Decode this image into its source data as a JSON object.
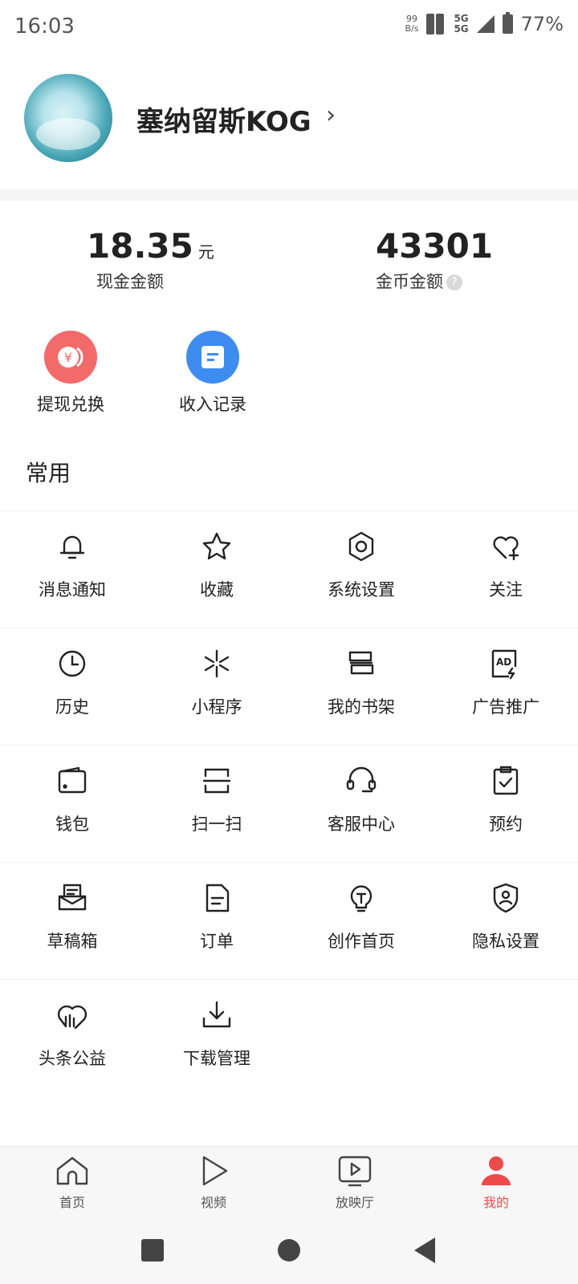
{
  "status_bar": {
    "time": "16:03",
    "net_speed_value": "99",
    "net_speed_unit": "B/s",
    "network_type_1": "5G",
    "network_type_2": "5G",
    "battery": "77%"
  },
  "profile": {
    "username": "塞纳留斯KOG",
    "chevron": "›"
  },
  "stats": {
    "cash_amount": "18.35",
    "cash_unit": "元",
    "cash_label": "现金金额",
    "coin_amount": "43301",
    "coin_label": "金币金额",
    "help_glyph": "?"
  },
  "quick_actions": {
    "withdraw_label": "提现兑换",
    "withdraw_icon_glyph": "¥",
    "income_label": "收入记录"
  },
  "section_title": "常用",
  "grid": {
    "items": [
      {
        "label": "消息通知",
        "icon": "bell-icon"
      },
      {
        "label": "收藏",
        "icon": "star-icon"
      },
      {
        "label": "系统设置",
        "icon": "gear-icon"
      },
      {
        "label": "关注",
        "icon": "heart-plus-icon"
      },
      {
        "label": "历史",
        "icon": "clock-icon"
      },
      {
        "label": "小程序",
        "icon": "mini-program-icon"
      },
      {
        "label": "我的书架",
        "icon": "bookshelf-icon"
      },
      {
        "label": "广告推广",
        "icon": "ad-icon"
      },
      {
        "label": "钱包",
        "icon": "wallet-icon"
      },
      {
        "label": "扫一扫",
        "icon": "scan-icon"
      },
      {
        "label": "客服中心",
        "icon": "headset-icon"
      },
      {
        "label": "预约",
        "icon": "clipboard-check-icon"
      },
      {
        "label": "草稿箱",
        "icon": "drafts-icon"
      },
      {
        "label": "订单",
        "icon": "document-icon"
      },
      {
        "label": "创作首页",
        "icon": "lightbulb-icon"
      },
      {
        "label": "隐私设置",
        "icon": "shield-user-icon"
      },
      {
        "label": "头条公益",
        "icon": "charity-heart-icon"
      },
      {
        "label": "下载管理",
        "icon": "download-icon"
      }
    ]
  },
  "tabbar": {
    "home": "首页",
    "video": "视频",
    "theater": "放映厅",
    "mine": "我的",
    "active_color": "#ef4a4a"
  }
}
